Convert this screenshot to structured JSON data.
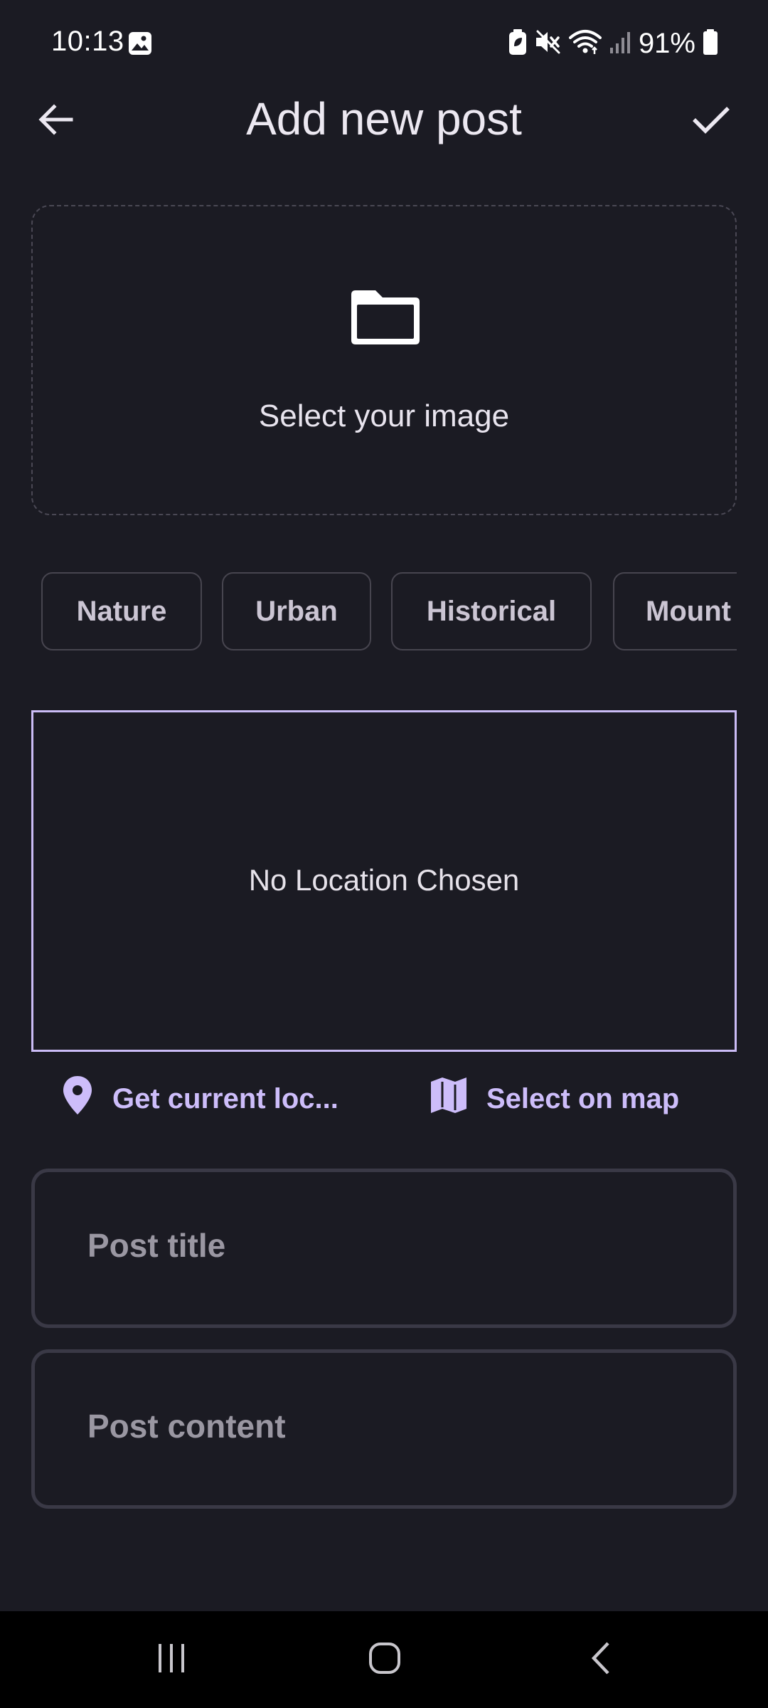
{
  "status_bar": {
    "time": "10:13",
    "battery": "91%",
    "icons": [
      "gallery-icon",
      "battery-saver-icon",
      "mute-icon",
      "wifi-icon",
      "signal-icon",
      "battery-icon"
    ]
  },
  "app_bar": {
    "title": "Add new post",
    "back_icon": "arrow-back-icon",
    "confirm_icon": "check-icon"
  },
  "image_picker": {
    "icon": "folder-icon",
    "label": "Select your image"
  },
  "categories": [
    {
      "label": "Nature"
    },
    {
      "label": "Urban"
    },
    {
      "label": "Historical"
    },
    {
      "label": "Mount"
    }
  ],
  "location": {
    "empty_text": "No Location Chosen",
    "current_location_label": "Get current loc...",
    "select_on_map_label": "Select on map"
  },
  "form": {
    "title_placeholder": "Post title",
    "content_placeholder": "Post content"
  },
  "nav_bar": {
    "icons": [
      "recent-apps-icon",
      "home-icon",
      "nav-back-icon"
    ]
  },
  "colors": {
    "background": "#1b1b23",
    "accent": "#cdbdfa",
    "field_border": "#3a3946",
    "chip_border": "#47454f"
  }
}
